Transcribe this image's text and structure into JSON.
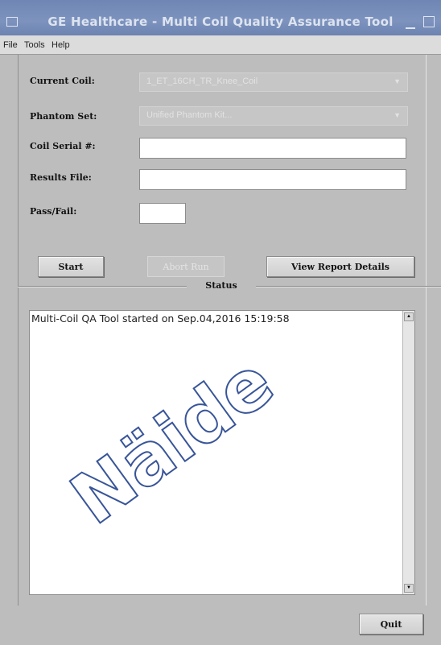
{
  "window": {
    "title": "GE Healthcare - Multi Coil Quality Assurance Tool"
  },
  "menu": [
    "File",
    "Tools",
    "Help"
  ],
  "form": {
    "current_coil_label": "Current Coil:",
    "current_coil_value": "1_ET_16CH_TR_Knee_Coil",
    "phantom_set_label": "Phantom Set:",
    "phantom_set_value": "Unified Phantom Kit...",
    "coil_serial_label": "Coil Serial #:",
    "coil_serial_value": "",
    "results_file_label": "Results File:",
    "results_file_value": "",
    "pass_fail_label": "Pass/Fail:",
    "pass_fail_value": ""
  },
  "buttons": {
    "start": "Start",
    "abort": "Abort Run",
    "view_report": "View Report Details",
    "quit": "Quit"
  },
  "status": {
    "title": "Status",
    "log": "Multi-Coil QA Tool started on Sep.04,2016 15:19:58"
  },
  "watermark": "Näide",
  "colors": {
    "background": "#bdbdbd",
    "titlebar": "#7a90bb",
    "watermark_outline": "#2e4c94"
  }
}
